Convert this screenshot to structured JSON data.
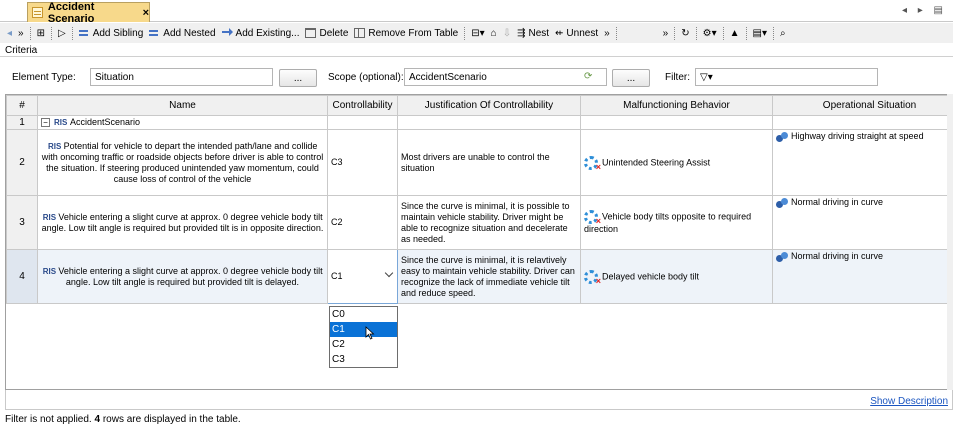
{
  "tab": {
    "title": "Accident Scenario",
    "close": "×",
    "nav": "◂ ▸ ▤"
  },
  "toolbar": {
    "more": "»",
    "add_sibling": "Add Sibling",
    "add_nested": "Add Nested",
    "add_existing": "Add Existing...",
    "delete": "Delete",
    "remove_from_table": "Remove From Table",
    "nest": "Nest",
    "unnest": "Unnest"
  },
  "criteria": {
    "title": "Criteria",
    "element_type_label": "Element Type:",
    "element_type_value": "Situation",
    "browse": "...",
    "scope_label": "Scope (optional):",
    "scope_value": "AccidentScenario",
    "filter_label": "Filter:",
    "filter_icon": "funnel-icon"
  },
  "table": {
    "columns": [
      "#",
      "Name",
      "Controllability",
      "Justification Of Controllability",
      "Malfunctioning Behavior",
      "Operational Situation"
    ],
    "rows": [
      {
        "num": "1",
        "name": "AccidentScenario",
        "controllability": "",
        "justification": "",
        "malfunction": "",
        "situation": ""
      },
      {
        "num": "2",
        "name": "Potential for vehicle to depart the intended path/lane and collide with oncoming traffic or roadside objects before driver is able to control the situation. If steering produced unintended yaw momentum, could cause loss of control of the vehicle",
        "controllability": "C3",
        "justification": "Most drivers are unable to control the situation",
        "malfunction": "Unintended Steering Assist",
        "situation": "Highway driving straight at speed"
      },
      {
        "num": "3",
        "name": "Vehicle entering a slight curve at approx. 0 degree vehicle body tilt angle. Low tilt angle is required but provided tilt is in opposite direction.",
        "controllability": "C2",
        "justification": "Since the curve is minimal, it is possible to maintain vehicle stability.  Driver might be able to recognize situation and decelerate as needed.",
        "malfunction": "Vehicle body tilts opposite to required direction",
        "situation": "Normal driving in curve"
      },
      {
        "num": "4",
        "name": "Vehicle entering a slight curve at approx. 0 degree vehicle body tilt angle. Low tilt angle is required but provided tilt is delayed.",
        "controllability": "C1",
        "justification": "Since the curve is minimal, it is relavtively easy to maintain vehicle stability.  Driver can recognize the lack of immediate vehicle  tilt and reduce speed.",
        "malfunction": "Delayed vehicle body tilt",
        "situation": "Normal driving in curve"
      }
    ]
  },
  "dropdown": {
    "options": [
      "C0",
      "C1",
      "C2",
      "C3"
    ],
    "selected": "C1"
  },
  "footer": {
    "show_description": "Show Description",
    "status_prefix": "Filter is not applied. ",
    "status_count": "4",
    "status_suffix": " rows are displayed in the table."
  }
}
